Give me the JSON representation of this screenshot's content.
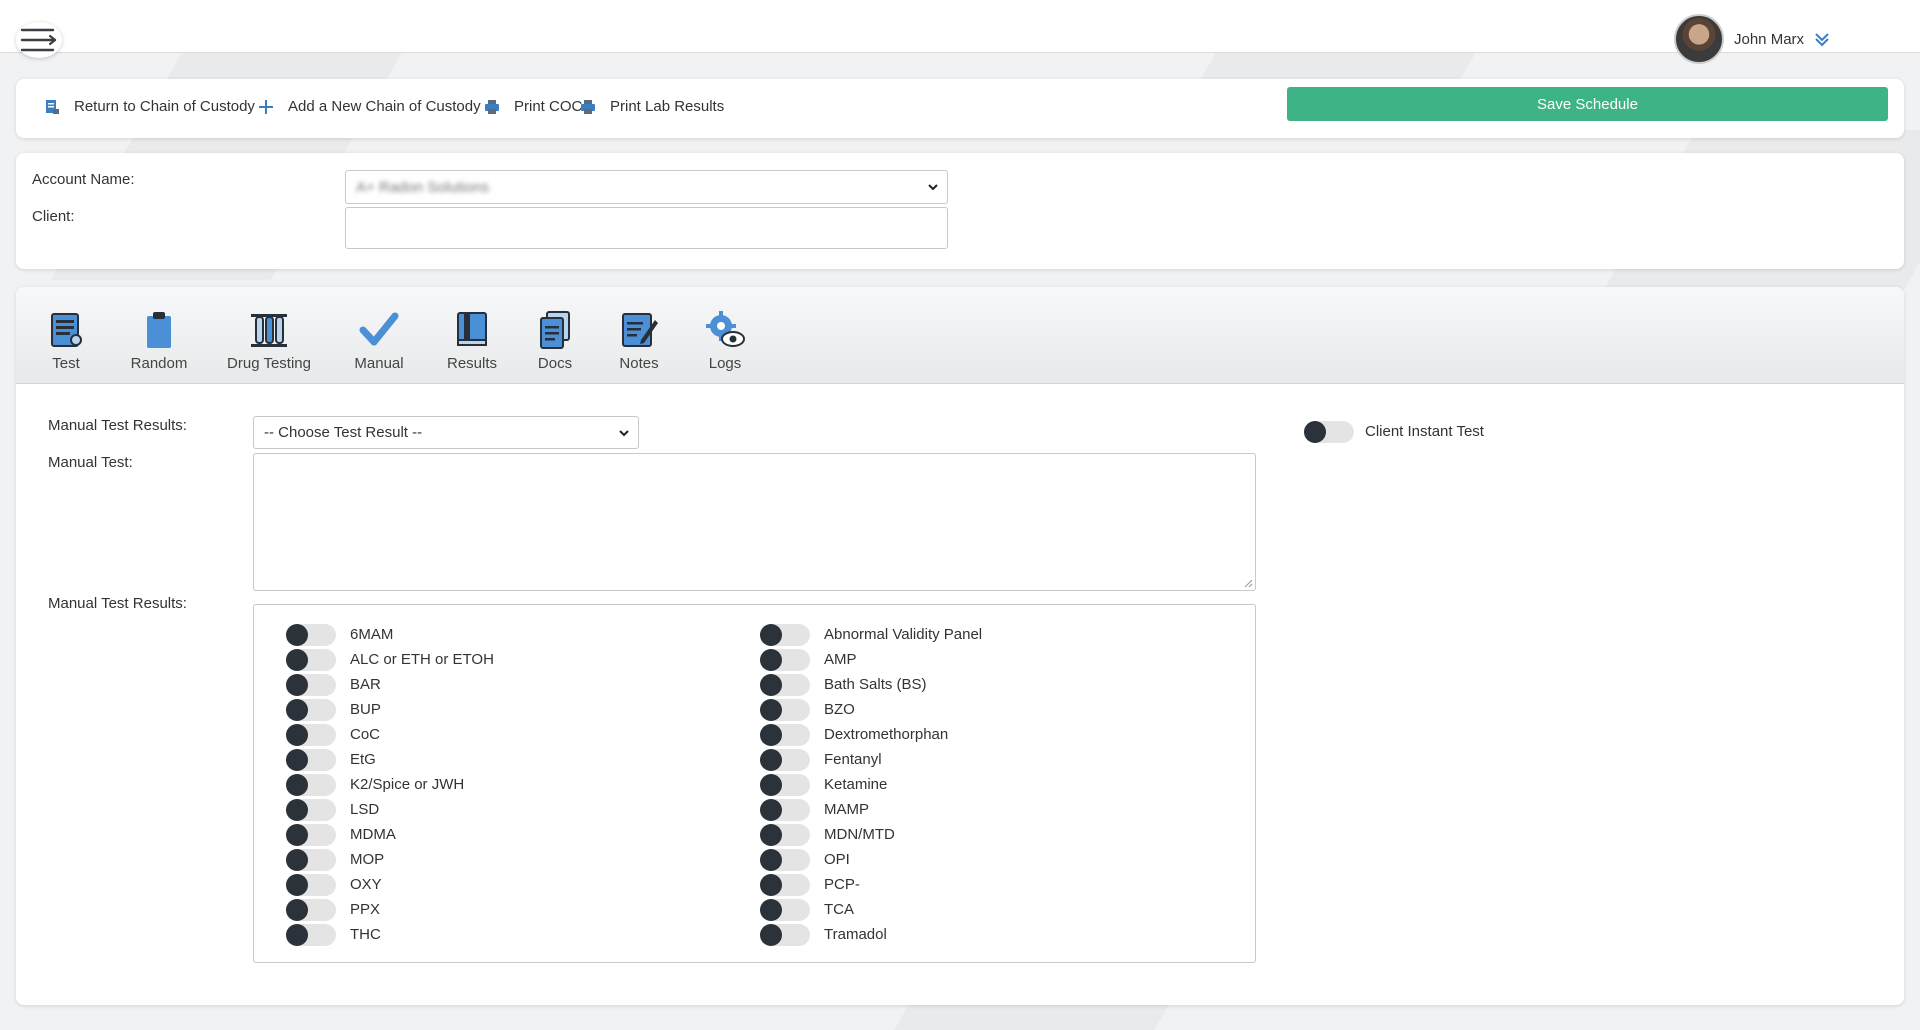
{
  "header": {
    "menu_icon": "hamburger-arrow-icon",
    "user_name": "John Marx"
  },
  "actions": {
    "return_label": "Return to Chain of Custody",
    "add_label": "Add a New Chain of Custody",
    "print_coc_label": "Print COC",
    "print_lab_label": "Print Lab Results",
    "save_label": "Save Schedule",
    "colors": {
      "save": "#3db386",
      "icon": "#3a7fc1"
    }
  },
  "account": {
    "account_name_label": "Account Name:",
    "account_name_value": "A+ Radon Solutions",
    "client_label": "Client:",
    "client_value": ""
  },
  "tabs": [
    {
      "label": "Test",
      "icon": "test-form-icon"
    },
    {
      "label": "Random",
      "icon": "clipboard-icon"
    },
    {
      "label": "Drug Testing",
      "icon": "test-tubes-icon"
    },
    {
      "label": "Manual",
      "icon": "checkmark-icon"
    },
    {
      "label": "Results",
      "icon": "book-icon"
    },
    {
      "label": "Docs",
      "icon": "documents-icon"
    },
    {
      "label": "Notes",
      "icon": "notes-pencil-icon"
    },
    {
      "label": "Logs",
      "icon": "gear-eye-icon"
    }
  ],
  "manual": {
    "results_label": "Manual Test Results:",
    "results_select": "-- Choose Test Result --",
    "test_label": "Manual Test:",
    "test_value": "",
    "results_list_label": "Manual Test Results:",
    "instant_test_label": "Client Instant Test"
  },
  "drugs_left": [
    "6MAM",
    "ALC or ETH or ETOH",
    "BAR",
    "BUP",
    "CoC",
    "EtG",
    "K2/Spice or JWH",
    "LSD",
    "MDMA",
    "MOP",
    "OXY",
    "PPX",
    "THC"
  ],
  "drugs_right": [
    "Abnormal Validity Panel",
    "AMP",
    "Bath Salts (BS)",
    "BZO",
    "Dextromethorphan",
    "Fentanyl",
    "Ketamine",
    "MAMP",
    "MDN/MTD",
    "OPI",
    "PCP-",
    "TCA",
    "Tramadol"
  ]
}
